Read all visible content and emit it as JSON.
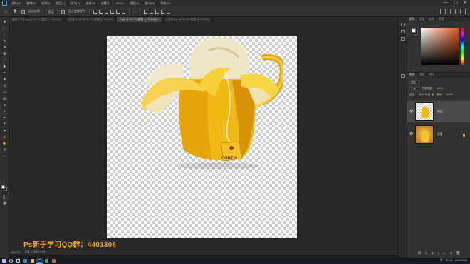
{
  "menubar": {
    "logo": "photoshop-icon",
    "items": [
      "文件(F)",
      "编辑(E)",
      "图像(I)",
      "图层(L)",
      "文字(Y)",
      "选择(S)",
      "滤镜(T)",
      "3D(D)",
      "视图(V)",
      "窗口(W)",
      "帮助(H)"
    ],
    "window_controls": [
      "—",
      "▢",
      "✕"
    ]
  },
  "options": {
    "auto_select_label": "自动选择：",
    "auto_select_value": "图层",
    "show_transform_label": "显示变换控件",
    "more_label": "···"
  },
  "tabs": [
    {
      "label": "香蕉工作室.jpg @ 54.2% (图层 1, RGB/8#)",
      "active": false
    },
    {
      "label": "文字设计.psd @ 66.7% (图层 1, RGB/8#)",
      "active": false
    },
    {
      "label": "6.jpg @ 66.7% (图层 1, RGB/8#) ×",
      "active": true
    },
    {
      "label": "合成图.psd @ 59.6% (图层 1, RGB/8#)",
      "active": false
    }
  ],
  "tools": [
    "move-icon",
    "marquee-icon",
    "lasso-icon",
    "quick-select-icon",
    "crop-icon",
    "frame-icon",
    "eyedropper-icon",
    "healing-icon",
    "brush-icon",
    "stamp-icon",
    "history-brush-icon",
    "eraser-icon",
    "gradient-icon",
    "blur-icon",
    "dodge-icon",
    "pen-icon",
    "type-icon",
    "path-select-icon",
    "rectangle-icon",
    "hand-icon",
    "zoom-icon",
    "more-tools-icon"
  ],
  "canvas": {
    "product_label": "CURTIS"
  },
  "watermark": "Ps新手学习QQ群：4401308",
  "status": {
    "zoom": "66.67%",
    "doc_info": "文档:1.34M/1.34M"
  },
  "color_panel": {
    "tabs": [
      "颜色",
      "色板",
      "渐变",
      "图案"
    ],
    "foreground": "#ffffff",
    "background": "#000000",
    "accent": "#e2561e"
  },
  "layers_panel": {
    "tabs": [
      "图层",
      "通道",
      "路径"
    ],
    "kind_label": "类型",
    "blend_mode": "正常",
    "opacity_label": "不透明度：",
    "opacity_value": "100%",
    "lock_label": "锁定：",
    "fill_label": "填充：",
    "fill_value": "100%",
    "layers": [
      {
        "name": "图层 1",
        "selected": true,
        "visible": true
      },
      {
        "name": "背景",
        "selected": false,
        "visible": true,
        "locked": true
      }
    ],
    "bottom_icons": [
      "link-icon",
      "fx-icon",
      "mask-icon",
      "adjustment-icon",
      "group-icon",
      "new-layer-icon",
      "trash-icon"
    ]
  },
  "taskbar": {
    "time": "21:14",
    "date": "2021/3/14",
    "tray_lang": "中"
  }
}
